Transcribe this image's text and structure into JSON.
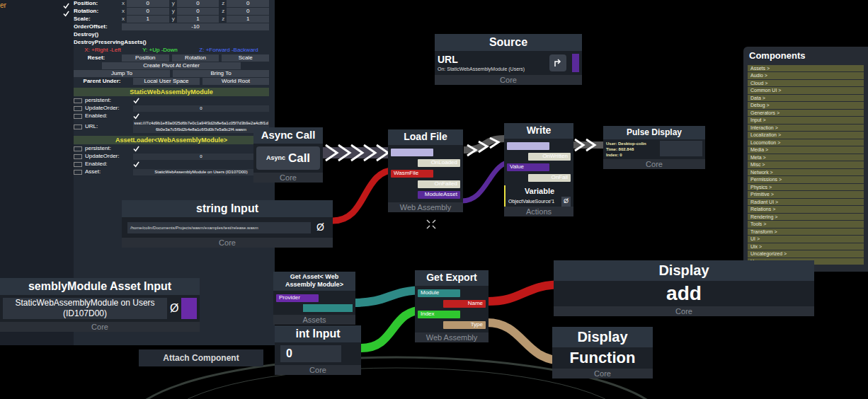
{
  "inspector": {
    "tree": [
      {
        "label": "er",
        "checked": true
      },
      {
        "label": "",
        "checked": true
      }
    ],
    "transform_rows": [
      {
        "label": "Position:",
        "values": [
          {
            "axis": "x",
            "value": "0"
          },
          {
            "axis": "y",
            "value": "0"
          },
          {
            "axis": "z",
            "value": "0"
          }
        ]
      },
      {
        "label": "Rotation:",
        "values": [
          {
            "axis": "x",
            "value": "0"
          },
          {
            "axis": "y",
            "value": "0"
          },
          {
            "axis": "z",
            "value": "0"
          }
        ]
      },
      {
        "label": "Scale:",
        "values": [
          {
            "axis": "x",
            "value": "1"
          },
          {
            "axis": "y",
            "value": "1"
          },
          {
            "axis": "z",
            "value": "1"
          }
        ]
      }
    ],
    "order_offset": {
      "label": "OrderOffset:",
      "value": "-10"
    },
    "actions": [
      "Destroy()",
      "DestroyPreservingAssets()"
    ],
    "axis_hints": [
      {
        "text": "X: +Right -Left",
        "color": "#ff4a4a"
      },
      {
        "text": "Y: +Up -Down",
        "color": "#4aff4a"
      },
      {
        "text": "Z: +Forward -Backward",
        "color": "#4a6aff"
      }
    ],
    "reset": {
      "label": "Reset:",
      "buttons": [
        "Position",
        "Rotation",
        "Scale"
      ]
    },
    "center_button": "Create Pivot At Center",
    "jump_buttons": [
      "Jump To",
      "Bring To"
    ],
    "parent_under": {
      "label": "Parent Under:",
      "buttons": [
        "Local User Space",
        "World Root"
      ]
    },
    "components": [
      {
        "title": "StaticWebAssemblyModule",
        "fields": [
          {
            "label": "persistent:",
            "kind": "check",
            "checked": true
          },
          {
            "label": "UpdateOrder:",
            "kind": "text",
            "value": "0"
          },
          {
            "label": "Enabled:",
            "kind": "check",
            "checked": true
          },
          {
            "label": "URL:",
            "kind": "text",
            "value": "ssst:///7c4d9b1e83a0f25d6b7e0c1a94f3d2b8e6a1c05f7d3b9e2a4c8f1d6b0e3a7c5f9d2b4e8a1c6f3d0b7e5a9c2f4.wasm"
          }
        ]
      },
      {
        "title": "AssetLoader<WebAssemblyModule>",
        "fields": [
          {
            "label": "persistent:",
            "kind": "check",
            "checked": true
          },
          {
            "label": "UpdateOrder:",
            "kind": "text",
            "value": "0"
          },
          {
            "label": "Enabled:",
            "kind": "check",
            "checked": true
          },
          {
            "label": "Asset:",
            "kind": "text",
            "value": "StaticWebAssemblyModule on Users (ID107D00)"
          }
        ]
      }
    ]
  },
  "components_panel": {
    "title": "Components",
    "items": [
      "Assets >",
      "Audio >",
      "Cloud >",
      "Common UI >",
      "Data >",
      "Debug >",
      "Generators >",
      "Input >",
      "Interaction >",
      "Localization >",
      "Locomotion >",
      "Media >",
      "Meta >",
      "Misc >",
      "Network >",
      "Permissions >",
      "Physics >",
      "Primitive >",
      "Radiant UI >",
      "Relations >",
      "Rendering >",
      "Tools >",
      "Transform >",
      "UI >",
      "Uix >",
      "Uncategorized >",
      "Users >"
    ]
  },
  "nodes": {
    "source": {
      "title": "Source",
      "label": "URL",
      "target": "On: StaticWebAssemblyModule (Users)",
      "footer": "Core"
    },
    "async_call": {
      "title": "Async Call",
      "prefix": "Async",
      "button": "Call",
      "footer": "Core"
    },
    "load_file": {
      "title": "Load File",
      "pins": [
        {
          "label": "",
          "side": "left",
          "color": "#b9b4e0"
        },
        {
          "label": "OnLoaded",
          "side": "right",
          "color": "#d8d8c8"
        },
        {
          "label": "WasmFile",
          "side": "left",
          "color": "#c02020"
        },
        {
          "label": "OnFailed",
          "side": "right",
          "color": "#d8d8c8"
        },
        {
          "label": "ModuleAsset",
          "side": "right",
          "color": "#5a2a9a"
        }
      ],
      "footer": "Web Assembly"
    },
    "write": {
      "title": "Write",
      "pins": [
        {
          "label": "",
          "side": "left",
          "color": "#b9b4e0"
        },
        {
          "label": "OnWritten",
          "side": "right",
          "color": "#d8d8c8"
        },
        {
          "label": "Value",
          "side": "left",
          "color": "#5a2a9a"
        },
        {
          "label": "OnFail",
          "side": "right",
          "color": "#d8d8c8"
        }
      ],
      "variable_title": "Variable",
      "variable_value": "ObjectValueSource'1",
      "variable_null": "Ø",
      "footer": "Actions"
    },
    "pulse_display": {
      "title": "Pulse Display",
      "lines": [
        "User: Desktop-colin",
        "Time: 802.848",
        "Index: 0"
      ],
      "footer": "Core"
    },
    "string_input": {
      "title": "string Input",
      "value": "/home/colin/Documents/Projects/wasm/examples/test/release.wasm",
      "null": "Ø",
      "footer": "Core"
    },
    "asset_input": {
      "title": "semblyModule Asset Input",
      "value": "StaticWebAssemblyModule on Users (ID107D00)",
      "null": "Ø",
      "footer": "Core"
    },
    "get_asset": {
      "title": "Get Asset< Web Assembly Module>",
      "pin": "Provider",
      "footer": "Assets"
    },
    "get_export": {
      "title": "Get Export",
      "pins": [
        {
          "label": "Module",
          "side": "left",
          "color": "#2e8a86"
        },
        {
          "label": "Name",
          "side": "right",
          "color": "#c02020"
        },
        {
          "label": "Index",
          "side": "left",
          "color": "#2fc72f"
        },
        {
          "label": "Type",
          "side": "right",
          "color": "#b89870"
        }
      ],
      "footer": "Web Assembly"
    },
    "int_input": {
      "title": "int Input",
      "value": "0",
      "footer": "Core"
    },
    "display_name": {
      "title": "Display",
      "value": "add",
      "footer": "Core"
    },
    "display_type": {
      "title": "Display",
      "value": "Function",
      "footer": "Core"
    }
  },
  "attach_button": "Attach Component"
}
